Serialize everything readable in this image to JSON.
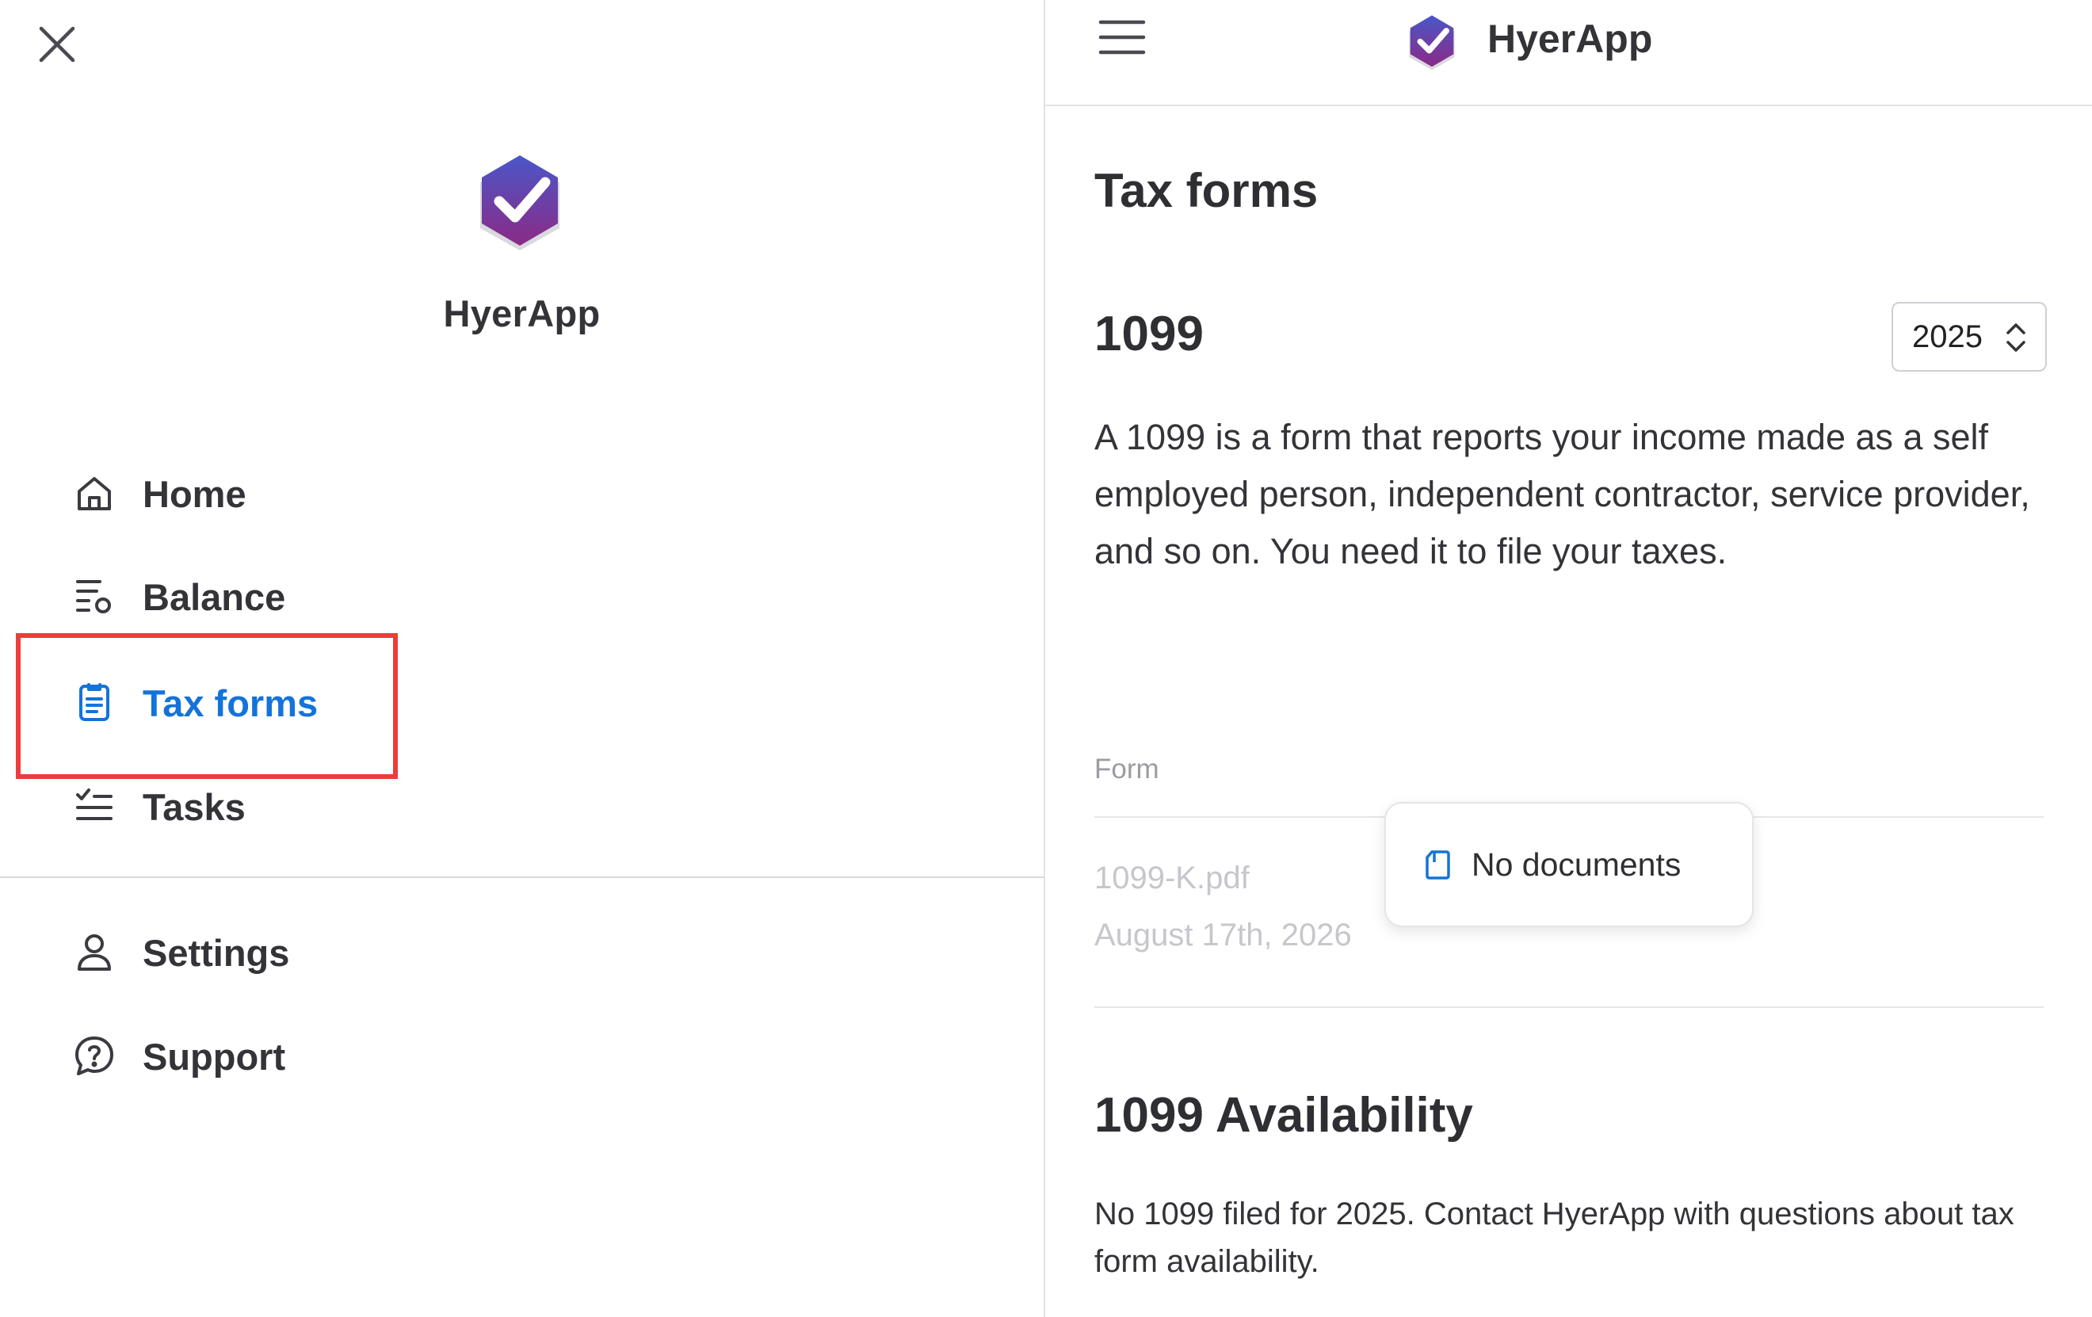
{
  "app": {
    "name": "HyerApp"
  },
  "colors": {
    "accent": "#1473d8",
    "highlight": "#ee3b3b",
    "logo_top": "#4a57c8",
    "logo_bottom": "#8b2a86"
  },
  "icons": {
    "close": "close-icon",
    "menu": "menu-icon",
    "logo": "hyerapp-logo",
    "home": "home-icon",
    "balance": "balance-icon",
    "tax_forms": "document-icon",
    "tasks": "tasks-icon",
    "settings": "user-icon",
    "support": "help-chat-icon",
    "year_select": "chevron-up-down-icon",
    "toast": "document-icon"
  },
  "sidebar": {
    "items": [
      {
        "label": "Home"
      },
      {
        "label": "Balance"
      },
      {
        "label": "Tax forms",
        "active": true
      },
      {
        "label": "Tasks"
      }
    ],
    "secondary_items": [
      {
        "label": "Settings"
      },
      {
        "label": "Support"
      }
    ]
  },
  "header": {
    "title": "HyerApp"
  },
  "main": {
    "title": "Tax forms",
    "section_title": "1099",
    "year_select": {
      "value": "2025"
    },
    "description": "A 1099 is a form that reports your income made as a self employed person, independent contractor, service provider, and so on. You need it to file your taxes.",
    "table": {
      "column_header": "Form",
      "rows": [
        {
          "file_name": "1099-K.pdf",
          "date": "August 17th, 2026"
        }
      ]
    },
    "toast": {
      "text": "No documents"
    },
    "availability": {
      "title": "1099 Availability",
      "text": "No 1099 filed for 2025. Contact HyerApp with questions about tax form availability."
    }
  }
}
